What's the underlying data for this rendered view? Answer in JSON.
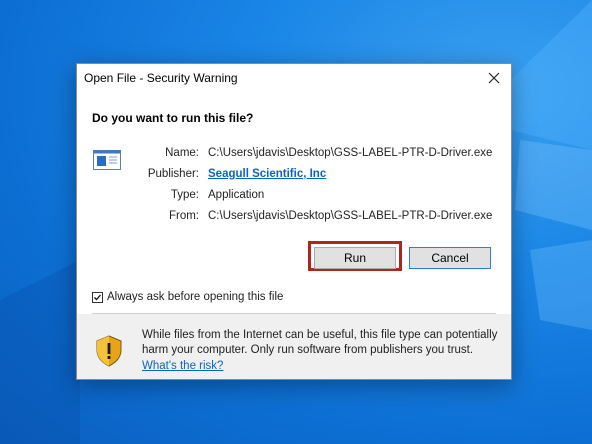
{
  "dialog": {
    "title": "Open File - Security Warning",
    "question": "Do you want to run this file?",
    "fields": {
      "name_label": "Name:",
      "name_value": "C:\\Users\\jdavis\\Desktop\\GSS-LABEL-PTR-D-Driver.exe",
      "publisher_label": "Publisher:",
      "publisher_value": "Seagull Scientific, Inc",
      "type_label": "Type:",
      "type_value": "Application",
      "from_label": "From:",
      "from_value": "C:\\Users\\jdavis\\Desktop\\GSS-LABEL-PTR-D-Driver.exe"
    },
    "buttons": {
      "run": "Run",
      "cancel": "Cancel"
    },
    "checkbox_label": "Always ask before opening this file",
    "checkbox_checked": true,
    "warning_text": "While files from the Internet can be useful, this file type can potentially harm your computer. Only run software from publishers you trust.",
    "risk_link": "What's the risk?",
    "icons": [
      "close-icon",
      "application-file-icon",
      "checkmark-icon",
      "security-shield-icon"
    ],
    "colors": {
      "highlight": "#b3241d",
      "link": "#0b63c9",
      "desktop": "#1a86e6"
    }
  }
}
